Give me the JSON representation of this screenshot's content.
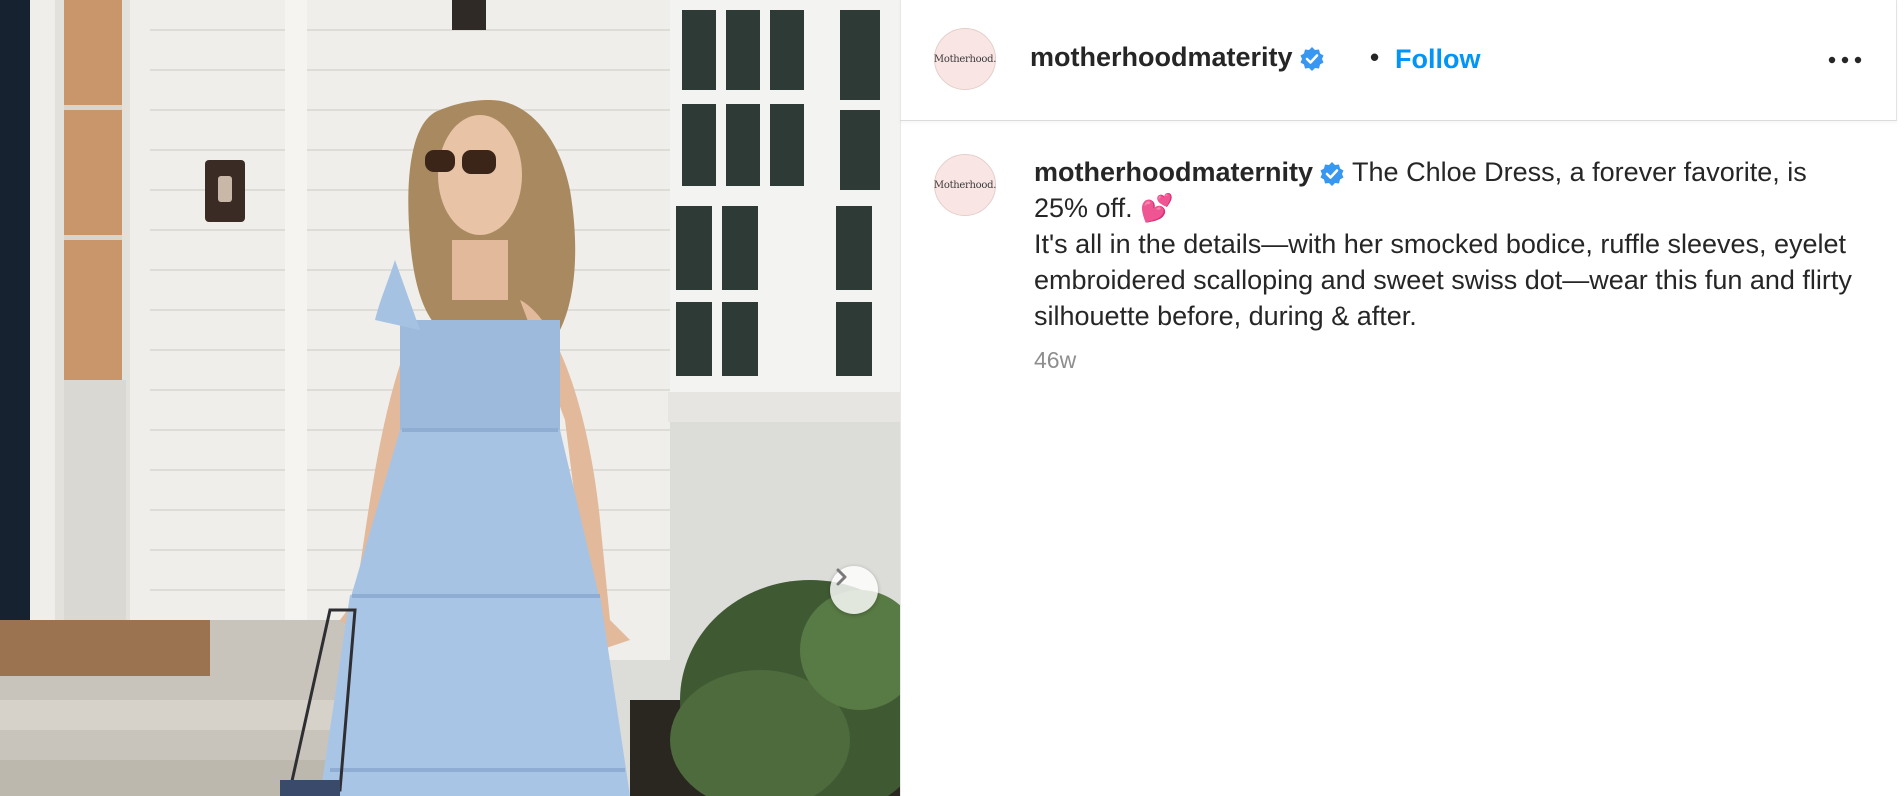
{
  "post": {
    "media": {
      "alt": "",
      "next_icon": "chevron-right-icon"
    },
    "header": {
      "avatar_text": "Motherhood.",
      "username": "motherhoodmaterity",
      "separator": "•",
      "follow_label": "Follow",
      "more_icon": "more-horizontal-icon"
    },
    "caption": {
      "avatar_text": "Motherhood.",
      "username": "motherhoodmaternity",
      "text": " The Chloe Dress, a forever favorite, is 25% off. 💕\nIt's all in the details—with her smocked bodice, ruffle sleeves, eyelet embroidered scalloping and sweet swiss dot—wear this fun and flirty silhouette before, during & after.",
      "timestamp": "46w"
    },
    "colors": {
      "accent": "#0095f6",
      "verified": "#3897f0",
      "text": "#262626",
      "muted": "#8e8e8e"
    }
  }
}
